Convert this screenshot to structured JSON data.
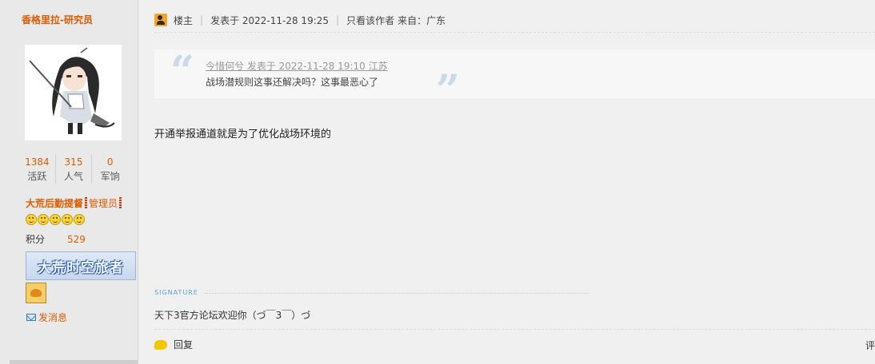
{
  "sidebar": {
    "author": "香格里拉-研究员",
    "stats": [
      {
        "value": "1384",
        "label": "活跃"
      },
      {
        "value": "315",
        "label": "人气"
      },
      {
        "value": "0",
        "label": "军饷"
      }
    ],
    "rank": "大荒后勤提督",
    "role": "管理员",
    "points_label": "积分",
    "points_value": "529",
    "medal_text": "大荒时空旅者",
    "pm_label": "发消息"
  },
  "post": {
    "floor_label": "楼主",
    "posted": "发表于 2022-11-28 19:25",
    "only_author": "只看该作者",
    "from": "来自：广东",
    "quote_header": "今惜何兮 发表于 2022-11-28 19:10 江苏",
    "quote_body": "战场潜规则这事还解决吗？这事最恶心了",
    "content": "开通举报通道就是为了优化战场环境的",
    "signature_label": "SIGNATURE",
    "signature": "天下3官方论坛欢迎你（づ￣3￣）づ",
    "reply_label": "回复",
    "right_cut": "评"
  },
  "colors": {
    "accent": "#e05b00",
    "quote_marks": "#cbd9ea",
    "signature_label": "#5da7c7"
  }
}
